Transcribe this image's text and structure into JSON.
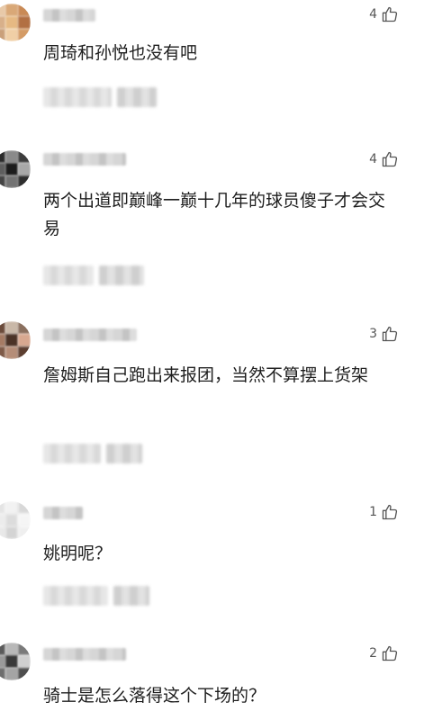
{
  "comments": [
    {
      "likes": "4",
      "text": "周琦和孙悦也没有吧"
    },
    {
      "likes": "4",
      "text": "两个出道即巅峰一巅十几年的球员傻子才会交易"
    },
    {
      "likes": "3",
      "text": "詹姆斯自己跑出来报团，当然不算摆上货架"
    },
    {
      "likes": "1",
      "text": "姚明呢？"
    },
    {
      "likes": "2",
      "text": "骑士是怎么落得这个下场的？"
    }
  ],
  "icons": {
    "like": "thumbs-up-outline-icon"
  },
  "colors": {
    "text": "#1e1e1e",
    "like_count": "#555555",
    "background": "#ffffff"
  }
}
